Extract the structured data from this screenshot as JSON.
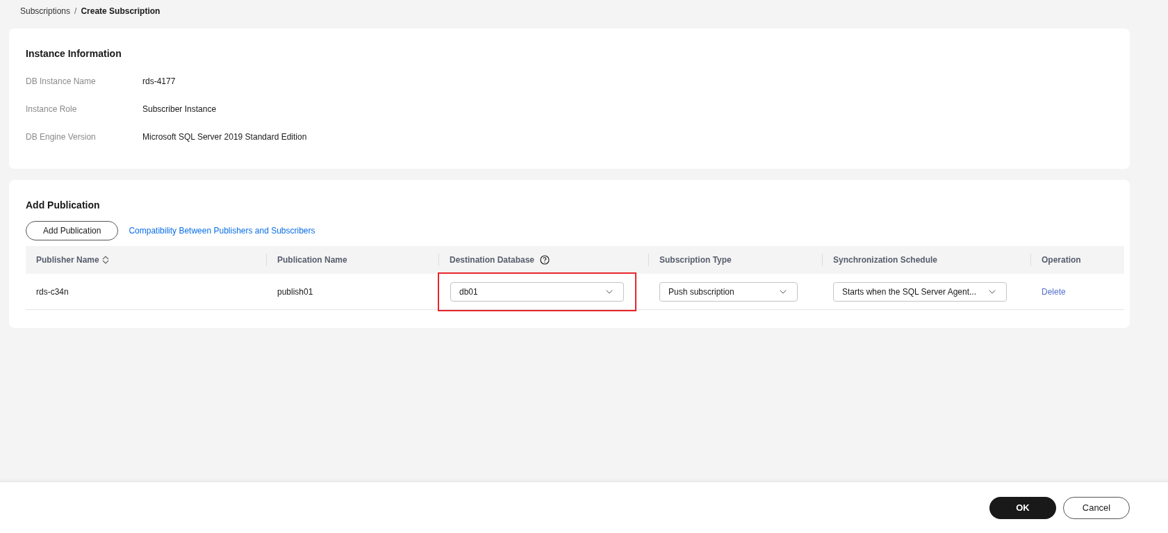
{
  "breadcrumb": [
    {
      "label": "Subscriptions",
      "current": false
    },
    {
      "label": "/",
      "kind": "separator"
    },
    {
      "label": "Create Subscription",
      "current": true
    }
  ],
  "instance_information": {
    "title": "Instance Information",
    "fields": [
      {
        "label": "DB Instance Name",
        "value": "rds-4177"
      },
      {
        "label": "Instance Role",
        "value": "Subscriber Instance"
      },
      {
        "label": "DB Engine Version",
        "value": "Microsoft SQL Server 2019 Standard Edition"
      }
    ]
  },
  "add_publication": {
    "title": "Add Publication",
    "button": "Add Publication",
    "link": "Compatibility Between Publishers and Subscribers",
    "table": {
      "columns": [
        {
          "label": "Publisher Name",
          "kind": "sortable"
        },
        {
          "label": "Publication Name",
          "kind": "plain"
        },
        {
          "label": "Destination Database",
          "kind": "help"
        },
        {
          "label": "Subscription Type",
          "kind": "plain"
        },
        {
          "label": "Synchronization Schedule",
          "kind": "plain"
        },
        {
          "label": "Operation",
          "kind": "plain"
        }
      ],
      "rows": [
        [
          {
            "kind": "text",
            "value": "rds-c34n"
          },
          {
            "kind": "text",
            "value": "publish01"
          },
          {
            "kind": "select",
            "value": "db01",
            "highlighted": true
          },
          {
            "kind": "select",
            "value": "Push subscription",
            "highlighted": false
          },
          {
            "kind": "select",
            "value": "Starts when the SQL Server Agent...",
            "highlighted": false
          },
          {
            "kind": "link",
            "value": "Delete"
          }
        ]
      ]
    }
  },
  "footer": {
    "buttons": [
      {
        "label": "OK",
        "primary": true
      },
      {
        "label": "Cancel",
        "primary": false
      }
    ]
  }
}
